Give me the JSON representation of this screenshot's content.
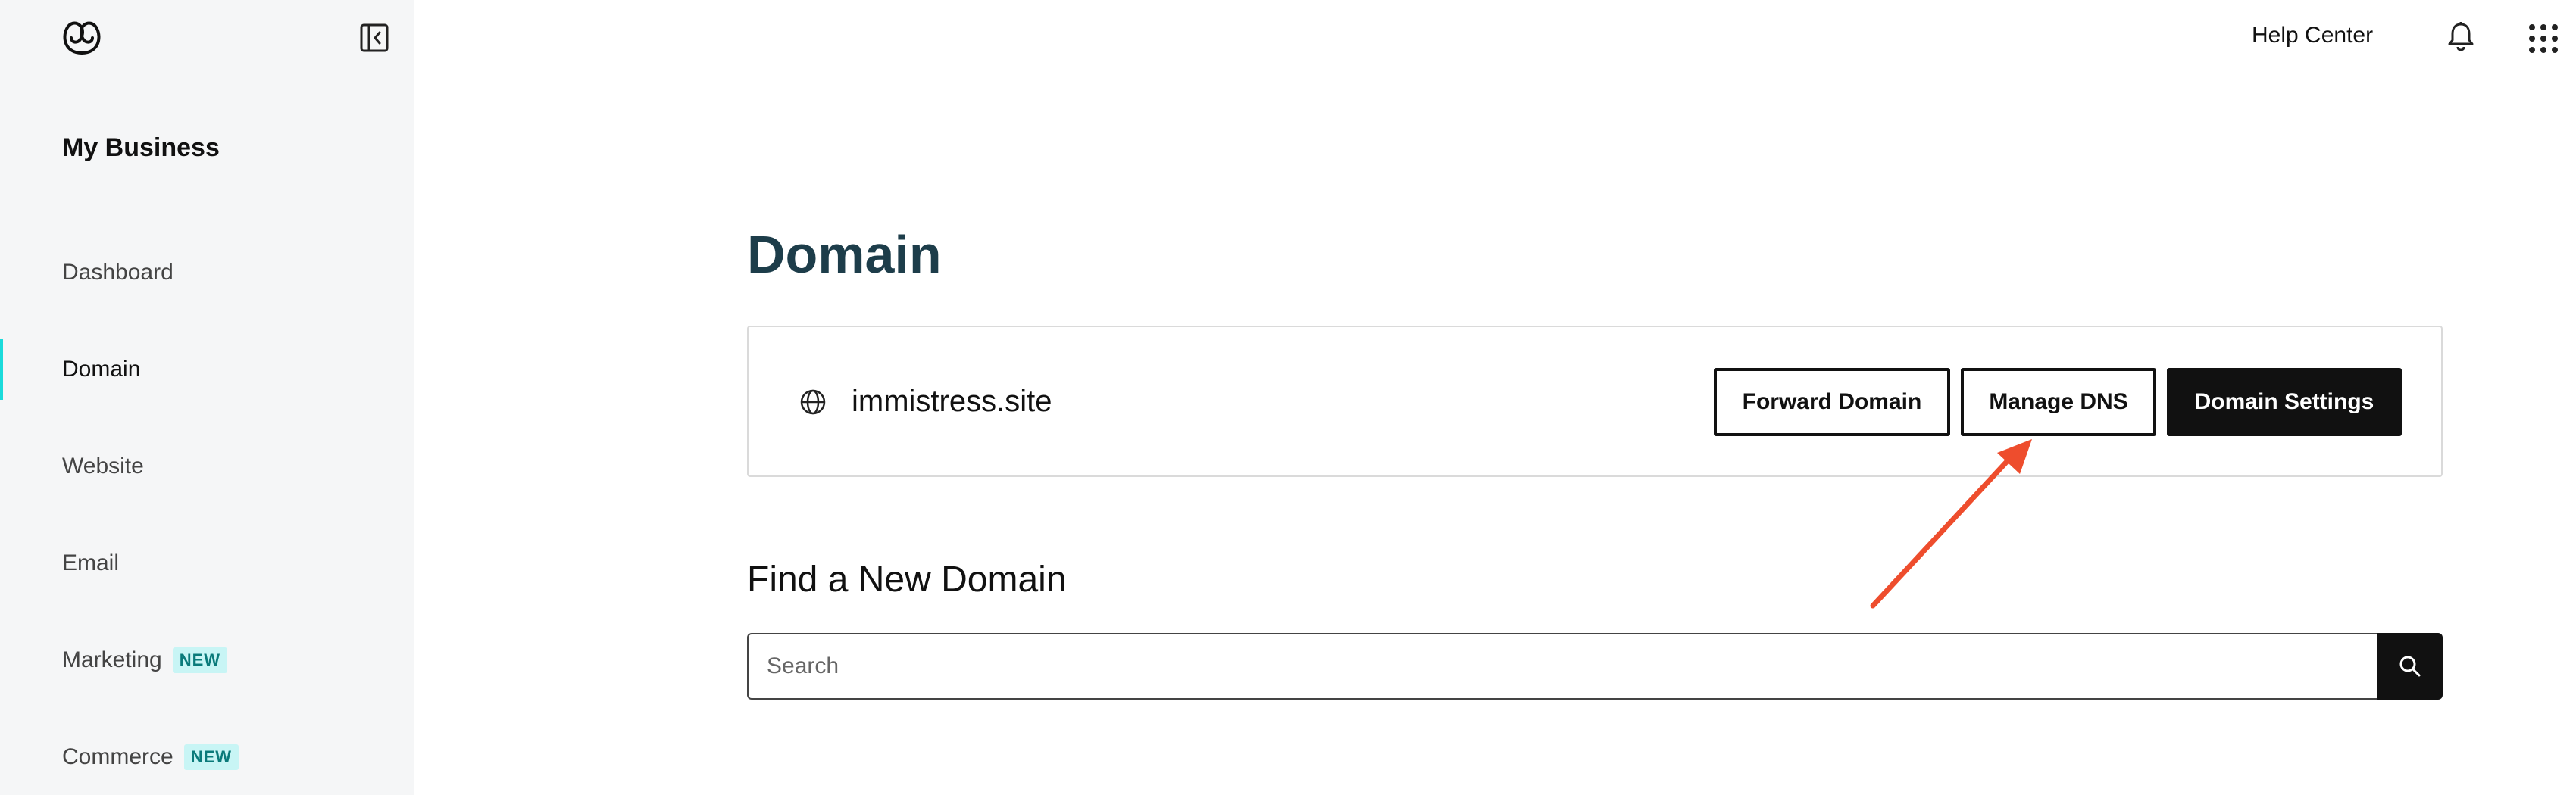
{
  "sidebar": {
    "business_title": "My Business",
    "items": [
      {
        "label": "Dashboard",
        "badge": ""
      },
      {
        "label": "Domain",
        "badge": ""
      },
      {
        "label": "Website",
        "badge": ""
      },
      {
        "label": "Email",
        "badge": ""
      },
      {
        "label": "Marketing",
        "badge": "NEW"
      },
      {
        "label": "Commerce",
        "badge": "NEW"
      }
    ],
    "active_item": "Domain"
  },
  "topbar": {
    "help_label": "Help Center",
    "icons": [
      "bell-icon",
      "apps-grid-icon"
    ]
  },
  "main": {
    "title": "Domain",
    "domain_card": {
      "domain": "immistress.site",
      "buttons": {
        "forward": "Forward Domain",
        "dns": "Manage DNS",
        "settings": "Domain Settings"
      }
    },
    "find_title": "Find a New Domain",
    "search": {
      "placeholder": "Search",
      "value": ""
    }
  },
  "annotation": {
    "arrow_color": "#ee4d2d",
    "points_to": "Manage DNS"
  },
  "colors": {
    "sidebar_bg": "#f5f6f7",
    "active_indicator": "#1bdbdb",
    "badge_bg": "#c8f5f5",
    "title_color": "#1d3d4a",
    "primary_button": "#111111"
  }
}
